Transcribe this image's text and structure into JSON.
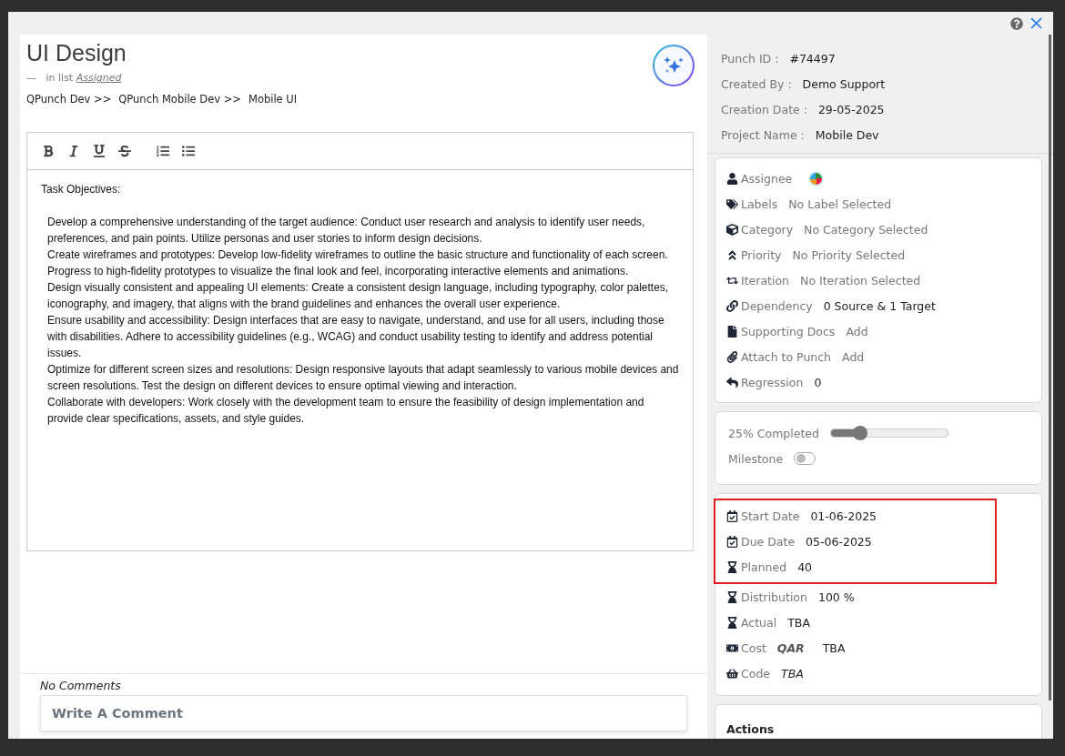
{
  "task": {
    "title": "UI Design",
    "list_prefix": "—",
    "list_label": "in list",
    "list_name": "Assigned",
    "breadcrumb": [
      "QPunch Dev >>",
      "QPunch Mobile Dev >>",
      "Mobile UI"
    ]
  },
  "editor": {
    "paragraphs": [
      "Task Objectives:",
      "Develop a comprehensive understanding of the target audience: Conduct user research and analysis to identify user needs, preferences, and pain points. Utilize personas and user stories to inform design decisions.",
      "Create wireframes and prototypes: Develop low-fidelity wireframes to outline the basic structure and functionality of each screen. Progress to high-fidelity prototypes to visualize the final look and feel, incorporating interactive elements and animations.",
      "Design visually consistent and appealing UI elements: Create a consistent design language, including typography, color palettes, iconography, and imagery, that aligns with the brand guidelines and enhances the overall user experience.",
      "Ensure usability and accessibility: Design interfaces that are easy to navigate, understand, and use for all users, including those with disabilities. Adhere to accessibility guidelines (e.g., WCAG) and conduct usability testing to identify and address potential issues.",
      "Optimize for different screen sizes and resolutions: Design responsive layouts that adapt seamlessly to various mobile devices and screen resolutions. Test the design on different devices to ensure optimal viewing and interaction.",
      "Collaborate with developers: Work closely with the development team to ensure the feasibility of design implementation and provide clear specifications, assets, and style guides."
    ]
  },
  "comments": {
    "empty_text": "No Comments",
    "placeholder": "Write A Comment"
  },
  "info": [
    {
      "label": "Punch ID :",
      "value": "#74497"
    },
    {
      "label": "Created By :",
      "value": "Demo Support"
    },
    {
      "label": "Creation Date :",
      "value": "29-05-2025"
    },
    {
      "label": "Project Name :",
      "value": "Mobile Dev"
    }
  ],
  "details": [
    {
      "kind": "avatar",
      "label": "Assignee"
    },
    {
      "kind": "text",
      "label": "Labels",
      "value": "No Label Selected",
      "muted": true
    },
    {
      "kind": "text",
      "label": "Category",
      "value": "No Category Selected",
      "muted": true
    },
    {
      "kind": "text",
      "label": "Priority",
      "value": "No Priority Selected",
      "muted": true
    },
    {
      "kind": "text",
      "label": "Iteration",
      "value": "No Iteration Selected",
      "muted": true
    },
    {
      "kind": "text",
      "label": "Dependency",
      "value": "0 Source & 1 Target",
      "muted": false
    },
    {
      "kind": "text",
      "label": "Supporting Docs",
      "value": "Add",
      "muted": true
    },
    {
      "kind": "text",
      "label": "Attach to Punch",
      "value": "Add",
      "muted": true
    },
    {
      "kind": "text",
      "label": "Regression",
      "value": "0",
      "muted": false
    }
  ],
  "progress": {
    "label": "25% Completed",
    "level": 0.25,
    "milestone_label": "Milestone",
    "milestone_on": false
  },
  "schedule": [
    {
      "kind": "text",
      "label": "Start Date",
      "value": "01-06-2025",
      "highlighted": true
    },
    {
      "kind": "text",
      "label": "Due Date",
      "value": "05-06-2025",
      "highlighted": true
    },
    {
      "kind": "text",
      "label": "Planned",
      "value": "40",
      "highlighted": true
    },
    {
      "kind": "text",
      "label": "Distribution",
      "value": "100 %",
      "highlighted": false
    },
    {
      "kind": "text",
      "label": "Actual",
      "value": "TBA",
      "highlighted": false
    },
    {
      "kind": "money",
      "label": "Cost",
      "currency": "QAR",
      "value": "TBA",
      "highlighted": false
    },
    {
      "kind": "code",
      "label": "Code",
      "value": "TBA",
      "highlighted": false
    }
  ],
  "actions": {
    "title": "Actions"
  }
}
